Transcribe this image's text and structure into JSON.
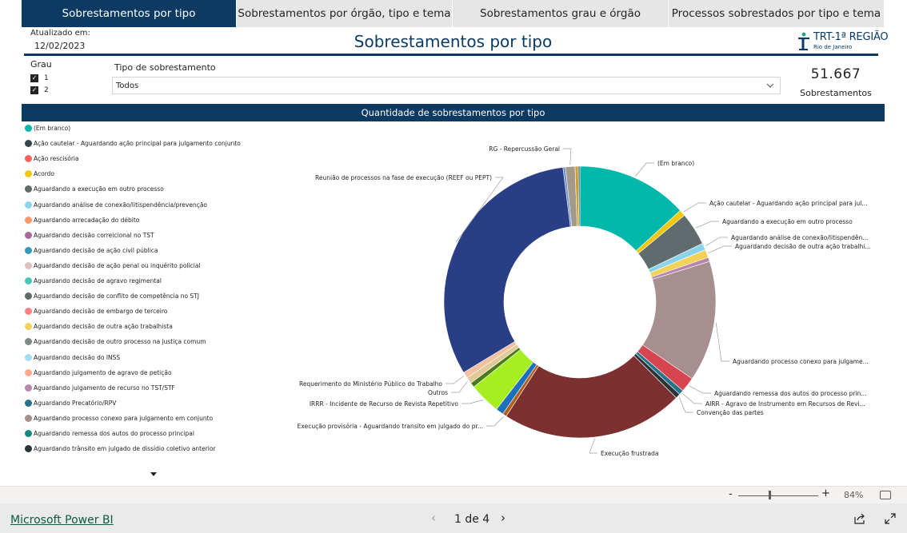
{
  "tabs": [
    {
      "label": "Sobrestamentos por tipo",
      "active": true
    },
    {
      "label": "Sobrestamentos por órgão, tipo e tema",
      "active": false
    },
    {
      "label": "Sobrestamentos grau e órgão",
      "active": false
    },
    {
      "label": "Processos sobrestados por tipo e tema",
      "active": false
    }
  ],
  "header": {
    "updated_label": "Atualizado em:",
    "updated_date": "12/02/2023",
    "title": "Sobrestamentos por tipo",
    "logo_text": "TRT-1ª REGIÃO",
    "logo_sub": "Rio de Janeiro"
  },
  "filters": {
    "grau_label": "Grau",
    "grau_options": [
      {
        "label": "1",
        "checked": true
      },
      {
        "label": "2",
        "checked": true
      }
    ],
    "tipo_label": "Tipo de sobrestamento",
    "tipo_value": "Todos"
  },
  "kpi": {
    "value": "51.667",
    "label": "Sobrestamentos"
  },
  "chart_data": {
    "type": "donut",
    "title": "Quantidade de sobrestamentos por tipo",
    "legend_position": "left",
    "legend": [
      {
        "label": "(Em branco)",
        "color": "#01b8aa"
      },
      {
        "label": "Ação cautelar - Aguardando ação principal para julgamento conjunto",
        "color": "#374649"
      },
      {
        "label": "Ação rescisória",
        "color": "#fd625e"
      },
      {
        "label": "Acordo",
        "color": "#f2c80f"
      },
      {
        "label": "Aguardando a execução em outro processo",
        "color": "#5f6b6d"
      },
      {
        "label": "Aguardando análise de conexão/litispendência/prevenção",
        "color": "#8ad4eb"
      },
      {
        "label": "Aguardando arrecadação do débito",
        "color": "#fe9666"
      },
      {
        "label": "Aguardando decisão correicional no TST",
        "color": "#a66999"
      },
      {
        "label": "Aguardando decisão de ação civil pública",
        "color": "#3599b8"
      },
      {
        "label": "Aguardando decisão de ação penal ou inquérito policial",
        "color": "#dfbfbf"
      },
      {
        "label": "Aguardando decisão de agravo regimental",
        "color": "#4ac5bb"
      },
      {
        "label": "Aguardando decisão de conflito de competência no STJ",
        "color": "#5f6b6d"
      },
      {
        "label": "Aguardando decisão de embargo de terceiro",
        "color": "#fb8281"
      },
      {
        "label": "Aguardando decisão de outra ação trabalhista",
        "color": "#f4d25a"
      },
      {
        "label": "Aguardando decisão de outro processo na justiça comum",
        "color": "#7f898a"
      },
      {
        "label": "Aguardando decisão do INSS",
        "color": "#a4ddee"
      },
      {
        "label": "Aguardando julgamento de agravo de petição",
        "color": "#fdab89"
      },
      {
        "label": "Aguardando julgamento de recurso no TST/STF",
        "color": "#b687ac"
      },
      {
        "label": "Aguardando Precatório/RPV",
        "color": "#28738a"
      },
      {
        "label": "Aguardando processo conexo para julgamento em conjunto",
        "color": "#a78f8f"
      },
      {
        "label": "Aguardando remessa dos autos do processo principal",
        "color": "#168980"
      },
      {
        "label": "Aguardando trânsito em julgado de dissídio coletivo anterior",
        "color": "#293537"
      }
    ],
    "slices": [
      {
        "label": "(Em branco)",
        "value": 6900,
        "color": "#01b8aa"
      },
      {
        "label": "Ação cautelar - Aguardando ação principal para jul...",
        "value": 390,
        "color": "#f2c80f"
      },
      {
        "label": "Aguardando a execução em outro processo",
        "value": 2050,
        "color": "#5f6b6d"
      },
      {
        "label": "Aguardando análise de conexão/litispendên...",
        "value": 420,
        "color": "#8ad4eb"
      },
      {
        "label": "Aguardando decisão de outra ação trabalhi...",
        "value": 500,
        "color": "#f4d25a"
      },
      {
        "label": "",
        "value": 260,
        "color": "#b687ac"
      },
      {
        "label": "Aguardando processo conexo para julgame...",
        "value": 7500,
        "color": "#a78f8f"
      },
      {
        "label": "Aguardando remessa dos autos do processo prin...",
        "value": 920,
        "color": "#d64550"
      },
      {
        "label": "AIRR - Agravo de Instrumento em Recursos de Revi...",
        "value": 300,
        "color": "#28738a"
      },
      {
        "label": "Convenção das partes",
        "value": 300,
        "color": "#293537"
      },
      {
        "label": "Execução frustrada",
        "value": 11300,
        "color": "#7c3030"
      },
      {
        "label": "Execução provisória - Aguardando transito em julgado do pr...",
        "value": 250,
        "color": "#b35d1e"
      },
      {
        "label": "",
        "value": 480,
        "color": "#1f6fbf"
      },
      {
        "label": "IRRR - Incidente de Recurso de Revista Repetitivo",
        "value": 1950,
        "color": "#a6ee21"
      },
      {
        "label": "",
        "value": 300,
        "color": "#4b7a1c"
      },
      {
        "label": "Outros",
        "value": 400,
        "color": "#e2c99a"
      },
      {
        "label": "Requerimento do Ministério Público do Trabalho",
        "value": 380,
        "color": "#f0c1a0"
      },
      {
        "label": "Reunião de processos na fase de execução (REEF ou PEPT)",
        "value": 16530,
        "color": "#2a3e86"
      },
      {
        "label": "",
        "value": 150,
        "color": "#6b8fd6"
      },
      {
        "label": "RG - Repercussão Geral",
        "value": 590,
        "color": "#a39a8a"
      },
      {
        "label": "",
        "value": 200,
        "color": "#c9a02e"
      },
      {
        "label": "",
        "value": 97,
        "color": "#3e5e6e"
      }
    ]
  },
  "zoom": {
    "minus": "-",
    "plus": "+",
    "level": "84%"
  },
  "footer": {
    "brand": "Microsoft Power BI",
    "page": "1 de 4",
    "prev": "‹",
    "next": "›"
  }
}
